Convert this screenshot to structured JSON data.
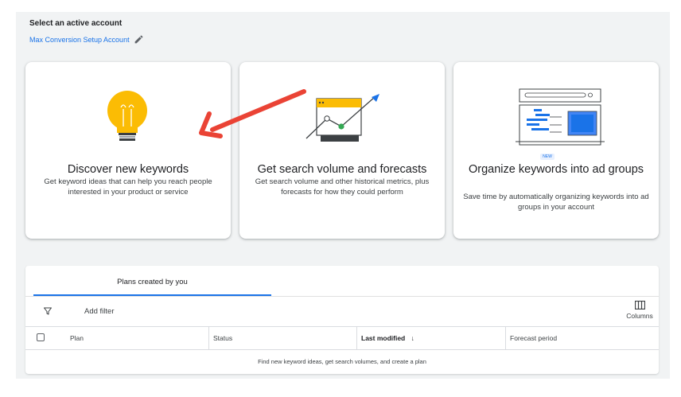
{
  "account": {
    "title": "Select an active account",
    "name": "Max Conversion Setup Account"
  },
  "cards": [
    {
      "title": "Discover new keywords",
      "description": "Get keyword ideas that can help you reach people interested in your product or service",
      "icon": "lightbulb-icon"
    },
    {
      "title": "Get search volume and forecasts",
      "description": "Get search volume and other historical metrics, plus forecasts for how they could perform",
      "icon": "forecast-chart-icon"
    },
    {
      "badge": "NEW",
      "title": "Organize keywords into ad groups",
      "description": "Save time by automatically organizing keywords into ad groups in your account",
      "icon": "ad-groups-icon"
    }
  ],
  "annotation": {
    "arrow_color": "#ea4335"
  },
  "plans": {
    "tab_label": "Plans created by you",
    "add_filter": "Add filter",
    "columns_label": "Columns",
    "headers": [
      "Plan",
      "Status",
      "Last modified",
      "Forecast period"
    ],
    "sort_indicator": "↓",
    "empty_message": "Find new keyword ideas, get search volumes, and create a plan"
  },
  "colors": {
    "accent": "#1a73e8",
    "bulb": "#fbbc04",
    "panel_bg": "#f1f3f4"
  }
}
